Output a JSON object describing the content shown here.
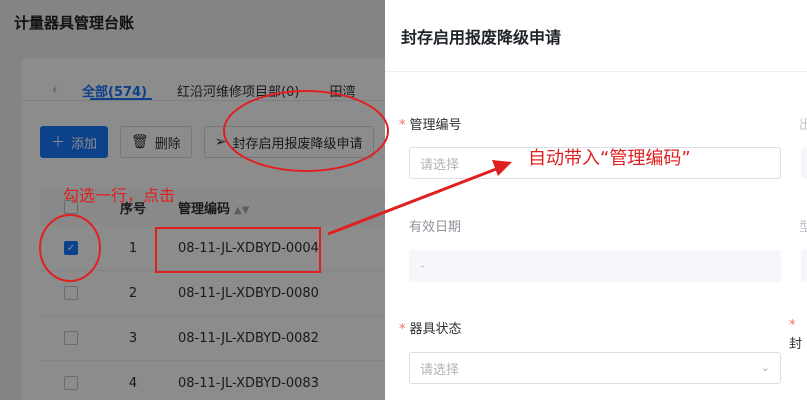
{
  "page": {
    "title": "计量器具管理台账"
  },
  "tabs": {
    "prev": "‹",
    "items": [
      {
        "label": "全部(574)"
      },
      {
        "label": "红沿河维修项目部(0)"
      },
      {
        "label": "田湾"
      }
    ]
  },
  "toolbar": {
    "add": "添加",
    "delete": "删除",
    "seal": "封存启用报废降级申请"
  },
  "table": {
    "headers": {
      "index": "序号",
      "code": "管理编码"
    },
    "rows": [
      {
        "index": "1",
        "code": "08-11-JL-XDBYD-0004",
        "checked": true
      },
      {
        "index": "2",
        "code": "08-11-JL-XDBYD-0080",
        "checked": false
      },
      {
        "index": "3",
        "code": "08-11-JL-XDBYD-0082",
        "checked": false
      },
      {
        "index": "4",
        "code": "08-11-JL-XDBYD-0083",
        "checked": false
      }
    ]
  },
  "drawer": {
    "title": "封存启用报废降级申请",
    "fields": {
      "manage_no_label": "管理编号",
      "manage_no_placeholder": "请选择",
      "valid_date_label": "有效日期",
      "valid_date_value": "-",
      "status_label": "器具状态",
      "status_placeholder": "请选择",
      "cut_right_1": "出",
      "cut_right_2": "型",
      "cut_right_3": "封"
    }
  },
  "annotations": {
    "select_row": "勾选一行，点击",
    "auto_fill": "自动带入“管理编码”"
  },
  "colors": {
    "primary": "#1677ff",
    "annotation": "#e02020",
    "required": "#f56c6c"
  }
}
